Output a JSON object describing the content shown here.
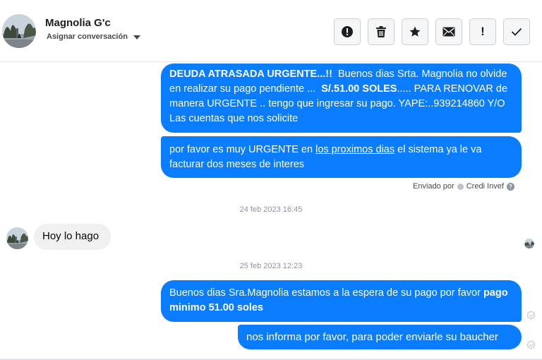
{
  "header": {
    "contact_name": "Magnolia G'c",
    "assign_label": "Asignar conversación",
    "actions": [
      {
        "icon": "alert-circle-icon"
      },
      {
        "icon": "trash-icon"
      },
      {
        "icon": "star-icon"
      },
      {
        "icon": "envelope-icon"
      },
      {
        "icon": "exclamation-icon",
        "glyph": "!"
      },
      {
        "icon": "checkmark-icon"
      }
    ]
  },
  "messages": {
    "m1": {
      "bold1": "DEUDA ATRASADA URGENTE...!!",
      "text1": "  Buenos dias Srta. Magnolia no olvide en realizar su pago pendiente ...  ",
      "bold2": "S/.51.00 SOLES",
      "text2": "..... PARA RENOVAR de manera URGENTE .. tengo que ingresar su pago. YAPE:..939214860 Y/O Las cuentas que nos solicite"
    },
    "m2": {
      "text1": "por favor es muy URGENTE en ",
      "link": "los proximos dias",
      "text2": " el sistema ya le va facturar dos meses de interes"
    },
    "sent_by_label": "Enviado por",
    "sent_by_name": "Credi Invef",
    "timestamp1": "24 feb 2023 16:45",
    "incoming": "Hoy lo hago",
    "timestamp2": "25 feb 2023 12:23",
    "m3": {
      "text1": "Buenos dias Sra.Magnolia estamos a la espera de su pago por favor ",
      "bold": "pago minimo 51.00 soles"
    },
    "m4": "nos informa por favor, para poder enviarle su baucher"
  },
  "colors": {
    "outgoing_bubble": "#0a7cff",
    "incoming_bubble": "#f0f0f0",
    "timestamp": "#8d949e"
  }
}
